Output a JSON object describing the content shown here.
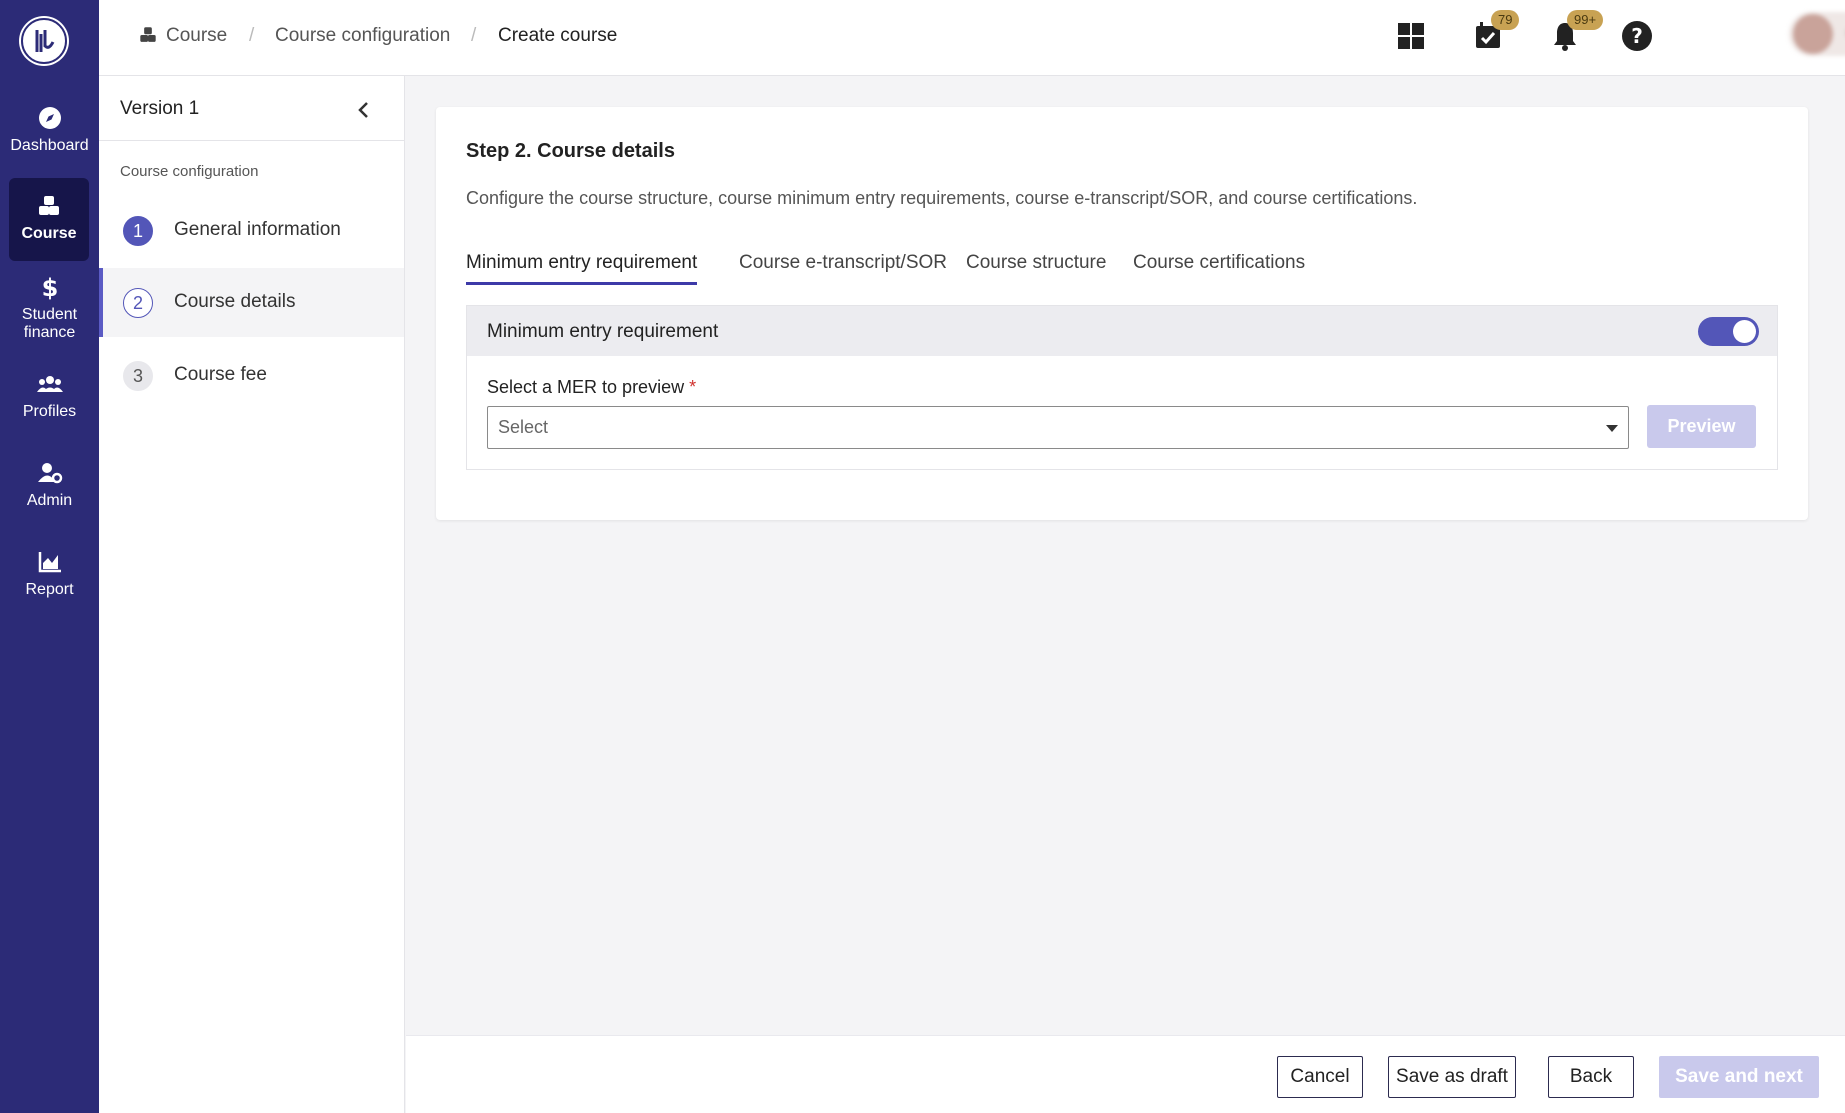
{
  "nav": {
    "items": [
      {
        "label": "Dashboard",
        "icon": "compass-icon"
      },
      {
        "label": "Course",
        "icon": "cubes-icon",
        "active": true
      },
      {
        "label_line1": "Student",
        "label_line2": "finance",
        "icon": "dollar-icon"
      },
      {
        "label": "Profiles",
        "icon": "users-icon"
      },
      {
        "label": "Admin",
        "icon": "user-gear-icon"
      },
      {
        "label": "Report",
        "icon": "chart-area-icon"
      }
    ]
  },
  "breadcrumb": {
    "items": [
      "Course",
      "Course configuration",
      "Create course"
    ],
    "separator": "/"
  },
  "topbar": {
    "tasks_badge": "79",
    "notifications_badge": "99+"
  },
  "sidebar": {
    "version": "Version 1",
    "section_label": "Course configuration",
    "steps": [
      {
        "num": "1",
        "label": "General information",
        "state": "done"
      },
      {
        "num": "2",
        "label": "Course details",
        "state": "active"
      },
      {
        "num": "3",
        "label": "Course fee",
        "state": "pending"
      }
    ]
  },
  "main": {
    "title": "Step 2. Course details",
    "description": "Configure the course structure, course minimum entry requirements, course e-transcript/SOR, and course certifications.",
    "tabs": [
      {
        "label": "Minimum entry requirement",
        "active": true
      },
      {
        "label": "Course e-transcript/SOR"
      },
      {
        "label": "Course structure"
      },
      {
        "label": "Course certifications"
      }
    ],
    "mer": {
      "header": "Minimum entry requirement",
      "toggle_on": true,
      "field_label": "Select a MER to preview",
      "required_mark": "*",
      "select_placeholder": "Select",
      "preview_label": "Preview"
    }
  },
  "footer": {
    "cancel": "Cancel",
    "save_draft": "Save as draft",
    "back": "Back",
    "save_next": "Save and next"
  },
  "colors": {
    "nav_bg": "#2c2b77",
    "accent": "#5356b8",
    "disabled_btn": "#c9c9ec",
    "badge": "#c8a253"
  }
}
